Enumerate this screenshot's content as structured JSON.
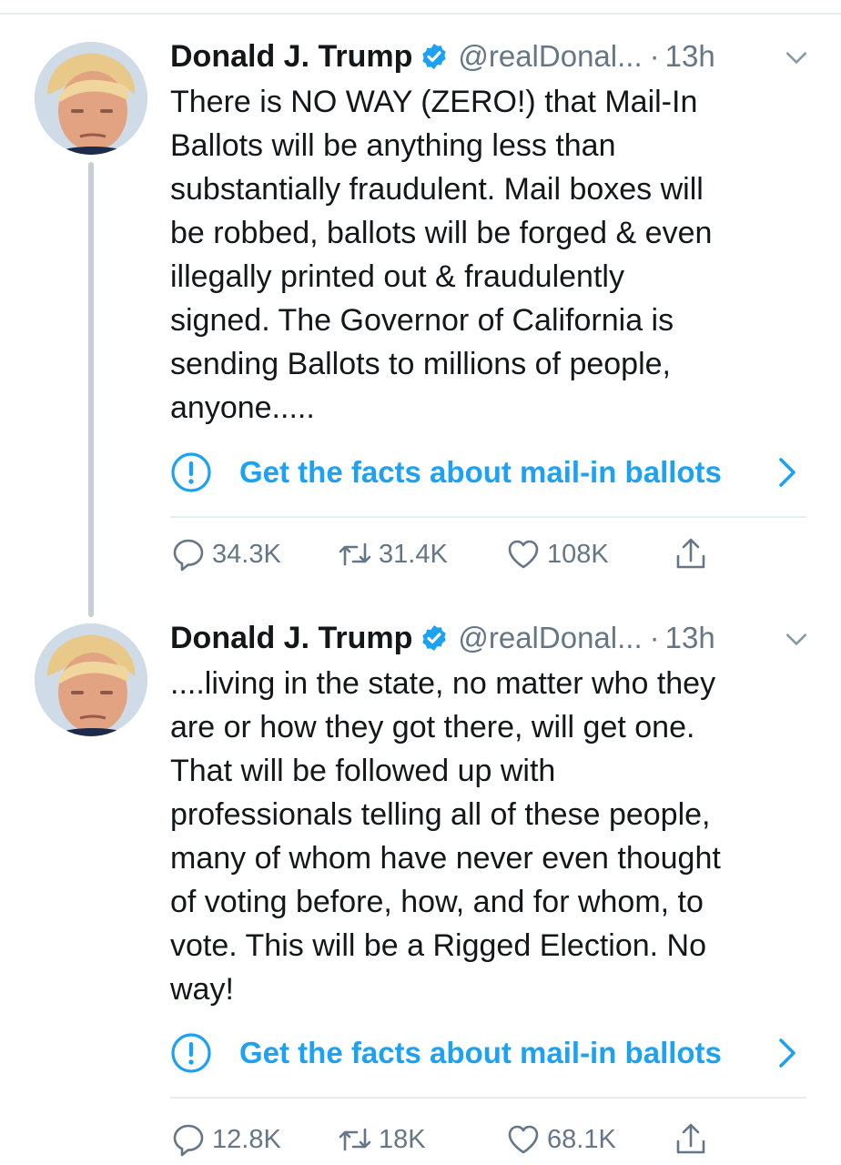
{
  "colors": {
    "accent": "#1da1f2",
    "text": "#14171a",
    "secondary_text": "#657786",
    "divider": "#e6ecf0",
    "thread_line": "#c4cfd6"
  },
  "tweets": [
    {
      "display_name": "Donald J. Trump",
      "verified_icon": "verified-badge-icon",
      "handle": "@realDonal...",
      "separator": "·",
      "time": "13h",
      "text": "There is NO WAY (ZERO!) that Mail-In\nBallots will be anything less than\nsubstantially fraudulent. Mail boxes will\nbe robbed, ballots will be forged & even\nillegally printed out & fraudulently\nsigned. The Governor of California is\nsending Ballots to millions of people,\nanyone.....",
      "fact_check_label": "Get the facts about mail-in ballots",
      "replies": "34.3K",
      "retweets": "31.4K",
      "likes": "108K"
    },
    {
      "display_name": "Donald J. Trump",
      "verified_icon": "verified-badge-icon",
      "handle": "@realDonal...",
      "separator": "·",
      "time": "13h",
      "text": "....living in the state, no matter who they\nare or how they got there, will get one.\nThat will be followed up with\nprofessionals telling all of these people,\nmany of whom have never even thought\nof voting before, how, and for whom, to\nvote. This will be a Rigged Election. No\nway!",
      "fact_check_label": "Get the facts about mail-in ballots",
      "replies": "12.8K",
      "retweets": "18K",
      "likes": "68.1K"
    }
  ]
}
